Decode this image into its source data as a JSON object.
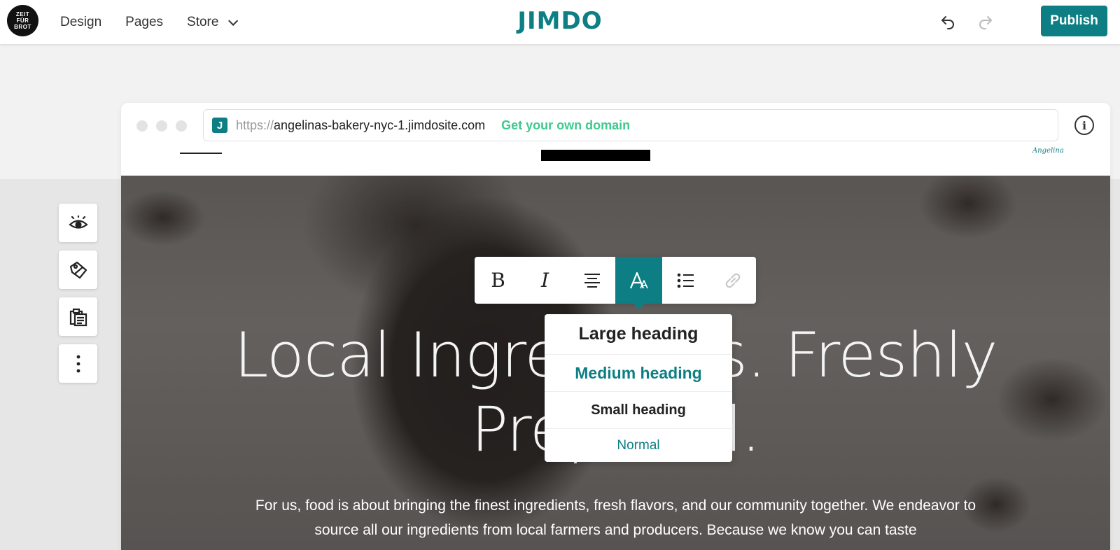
{
  "topbar": {
    "logo_lines": [
      "ZEIT",
      "FÜR",
      "BROT"
    ],
    "nav": [
      {
        "label": "Design"
      },
      {
        "label": "Pages"
      },
      {
        "label": "Store"
      }
    ],
    "brand": "JIMDO",
    "publish_label": "Publish"
  },
  "browser": {
    "url_protocol": "https://",
    "url_host": "angelinas-bakery-nyc-1.jimdosite.com",
    "get_domain_label": "Get your own domain",
    "site_logo_text": "Angelina"
  },
  "hero": {
    "title_line1": "Local Ingredients. Freshly",
    "title_line2": "Prepared.",
    "body": "For us, food is about bringing the finest ingredients, fresh flavors, and our community together. We endeavor to source all our ingredients from local farmers and producers. Because we know you can taste"
  },
  "left_tools": [
    {
      "icon": "eye-icon"
    },
    {
      "icon": "tag-icon"
    },
    {
      "icon": "clipboard-icon"
    },
    {
      "icon": "more-vertical-icon"
    }
  ],
  "format_toolbar": {
    "buttons": [
      {
        "icon": "bold-icon",
        "glyph": "B"
      },
      {
        "icon": "italic-icon",
        "glyph": "I"
      },
      {
        "icon": "align-center-icon"
      },
      {
        "icon": "text-style-icon",
        "active": true
      },
      {
        "icon": "list-icon"
      },
      {
        "icon": "link-icon"
      }
    ]
  },
  "heading_menu": {
    "items": [
      {
        "label": "Large heading"
      },
      {
        "label": "Medium heading",
        "selected": true
      },
      {
        "label": "Small heading"
      },
      {
        "label": "Normal"
      }
    ]
  },
  "colors": {
    "accent": "#0d7f84",
    "domain_link": "#3ec98f"
  }
}
